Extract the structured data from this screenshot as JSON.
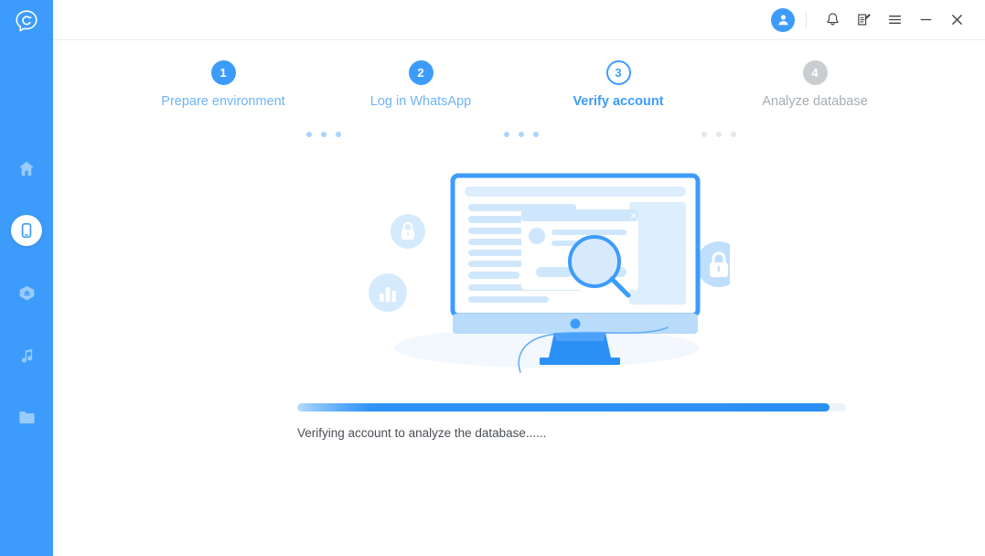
{
  "window": {
    "titlebar": {
      "avatar_icon": "user-avatar-icon",
      "notifications_icon": "bell-icon",
      "feedback_icon": "edit-note-icon",
      "menu_icon": "hamburger-menu-icon",
      "minimize_icon": "minimize-icon",
      "close_icon": "close-icon"
    }
  },
  "sidebar": {
    "background_color": "#3d9cfb",
    "logo": {
      "icon": "app-logo-chat-icon"
    },
    "items": [
      {
        "icon": "home-icon",
        "name": "home",
        "active": false
      },
      {
        "icon": "phone-device-icon",
        "name": "device",
        "active": true
      },
      {
        "icon": "cloud-backup-icon",
        "name": "backup",
        "active": false
      },
      {
        "icon": "music-note-icon",
        "name": "music",
        "active": false
      },
      {
        "icon": "folder-icon",
        "name": "files",
        "active": false
      }
    ]
  },
  "steps": {
    "accent_color": "#3d9cfb",
    "inactive_color": "#c9cdd2",
    "items": [
      {
        "number": "1",
        "label": "Prepare environment",
        "state": "done"
      },
      {
        "number": "2",
        "label": "Log in WhatsApp",
        "state": "done"
      },
      {
        "number": "3",
        "label": "Verify account",
        "state": "current"
      },
      {
        "number": "4",
        "label": "Analyze database",
        "state": "todo"
      }
    ]
  },
  "illustration": {
    "name": "monitor-search-database-illustration",
    "badges": [
      {
        "icon": "lock-icon",
        "size": "small"
      },
      {
        "icon": "bar-chart-icon",
        "size": "small"
      },
      {
        "icon": "lock-icon",
        "size": "large"
      }
    ],
    "screen_icon": "magnifier-icon"
  },
  "progress": {
    "percent": 97,
    "fill_color": "#2a90f5",
    "track_color": "#eef3f7",
    "status_text": "Verifying account to analyze the database......"
  }
}
